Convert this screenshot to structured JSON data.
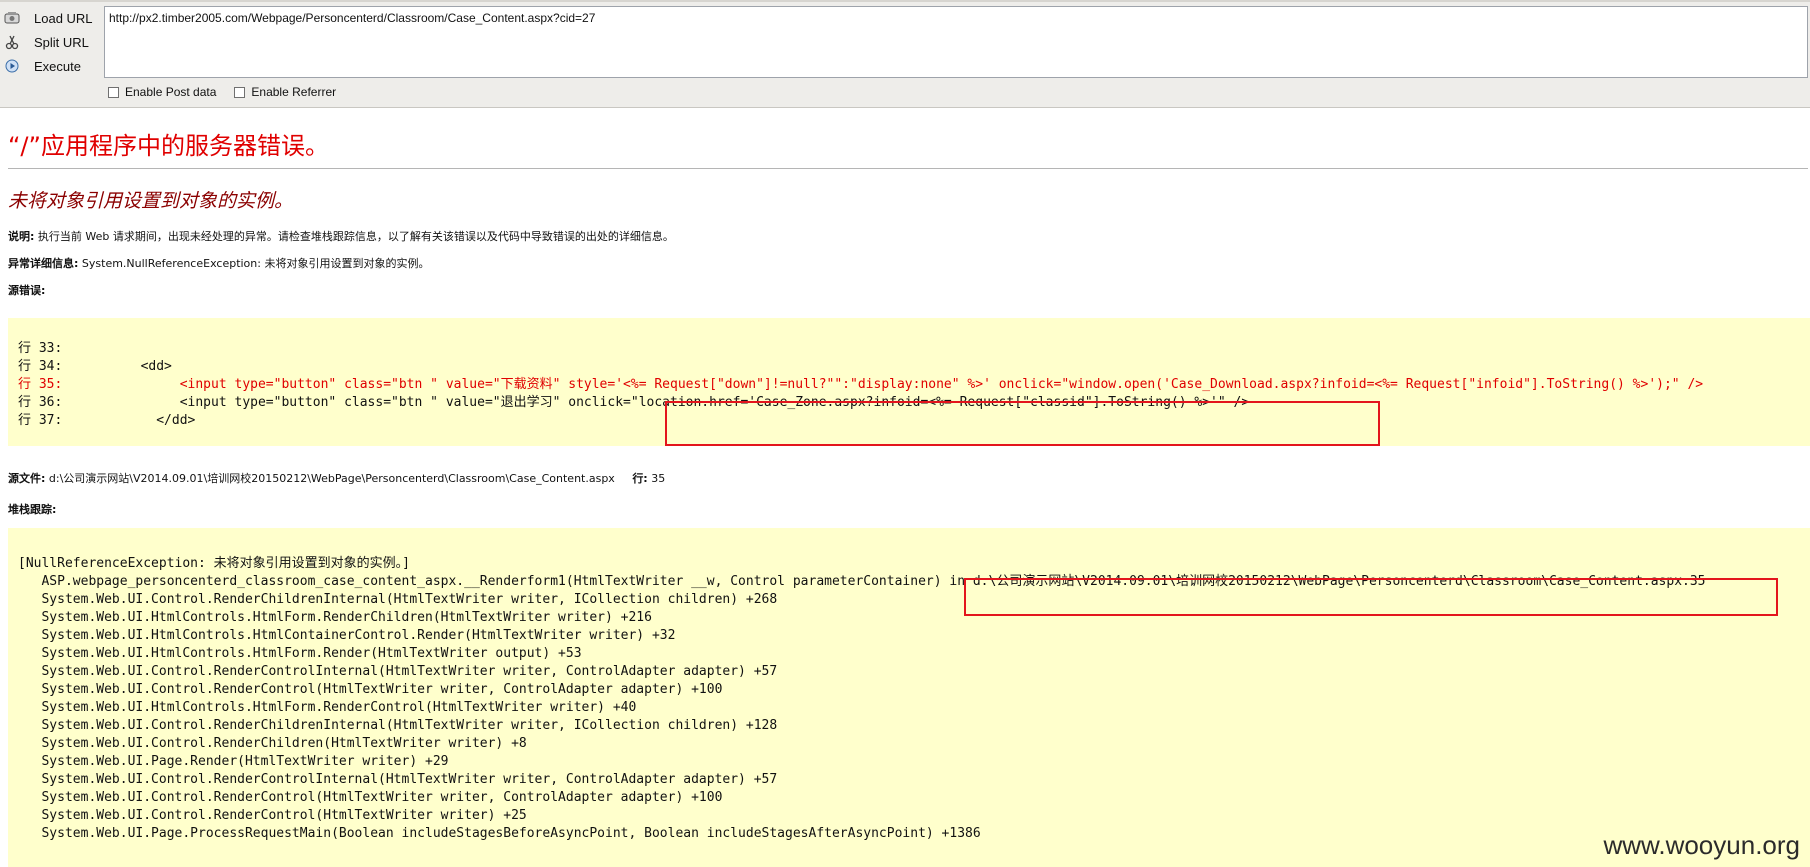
{
  "hackbar": {
    "actions": [
      {
        "label": "Load URL",
        "icon": "load-url-icon"
      },
      {
        "label": "Split URL",
        "icon": "split-url-icon"
      },
      {
        "label": "Execute",
        "icon": "execute-icon"
      }
    ],
    "url": "http://px2.timber2005.com/Webpage/Personcenterd/Classroom/Case_Content.aspx?cid=27",
    "options": {
      "post_label": "Enable Post data",
      "referrer_label": "Enable Referrer"
    }
  },
  "error": {
    "title": "“/”应用程序中的服务器错误。",
    "subtitle": "未将对象引用设置到对象的实例。",
    "description_label": "说明:",
    "description": "执行当前 Web 请求期间，出现未经处理的异常。请检查堆栈跟踪信息，以了解有关该错误以及代码中导致错误的出处的详细信息。",
    "exception_label": "异常详细信息:",
    "exception": "System.NullReferenceException: 未将对象引用设置到对象的实例。",
    "source_error_label": "源错误:",
    "source_lines": [
      "行 33:",
      "行 34:          <dd>",
      "行 35:               <input type=\"button\" class=\"btn \" value=\"下载资料\" style='<%= Request[\"down\"]!=null?\"\":\"display:none\" %>' onclick=\"window.open('Case_Download.aspx?infoid=<%= Request[\"infoid\"].ToString() %>');\" />",
      "行 36:               <input type=\"button\" class=\"btn \" value=\"退出学习\" onclick=\"location.href='Case_Zone.aspx?infoid=<%= Request[\"classid\"].ToString() %>'\" />",
      "行 37:            </dd>"
    ],
    "source_file_label": "源文件:",
    "source_file": "d:\\公司演示网站\\V2014.09.01\\培训网校20150212\\WebPage\\Personcenterd\\Classroom\\Case_Content.aspx",
    "line_label": "行:",
    "line_number": "35",
    "stack_trace_label": "堆栈跟踪:",
    "stack_lines": [
      "[NullReferenceException: 未将对象引用设置到对象的实例。]",
      "   ASP.webpage_personcenterd_classroom_case_content_aspx.__Renderform1(HtmlTextWriter __w, Control parameterContainer) in d:\\公司演示网站\\V2014.09.01\\培训网校20150212\\WebPage\\Personcenterd\\Classroom\\Case_Content.aspx:35",
      "   System.Web.UI.Control.RenderChildrenInternal(HtmlTextWriter writer, ICollection children) +268",
      "   System.Web.UI.HtmlControls.HtmlForm.RenderChildren(HtmlTextWriter writer) +216",
      "   System.Web.UI.HtmlControls.HtmlContainerControl.Render(HtmlTextWriter writer) +32",
      "   System.Web.UI.HtmlControls.HtmlForm.Render(HtmlTextWriter output) +53",
      "   System.Web.UI.Control.RenderControlInternal(HtmlTextWriter writer, ControlAdapter adapter) +57",
      "   System.Web.UI.Control.RenderControl(HtmlTextWriter writer, ControlAdapter adapter) +100",
      "   System.Web.UI.HtmlControls.HtmlForm.RenderControl(HtmlTextWriter writer) +40",
      "   System.Web.UI.Control.RenderChildrenInternal(HtmlTextWriter writer, ICollection children) +128",
      "   System.Web.UI.Control.RenderChildren(HtmlTextWriter writer) +8",
      "   System.Web.UI.Page.Render(HtmlTextWriter writer) +29",
      "   System.Web.UI.Control.RenderControlInternal(HtmlTextWriter writer, ControlAdapter adapter) +57",
      "   System.Web.UI.Control.RenderControl(HtmlTextWriter writer, ControlAdapter adapter) +100",
      "   System.Web.UI.Control.RenderControl(HtmlTextWriter writer) +25",
      "   System.Web.UI.Page.ProcessRequestMain(Boolean includeStagesBeforeAsyncPoint, Boolean includeStagesAfterAsyncPoint) +1386"
    ]
  },
  "watermark": "www.wooyun.org",
  "colors": {
    "title_red": "#e00000",
    "subtitle_maroon": "#8b0000",
    "code_bg": "#ffffcc",
    "annotation_red": "#e3151d"
  }
}
